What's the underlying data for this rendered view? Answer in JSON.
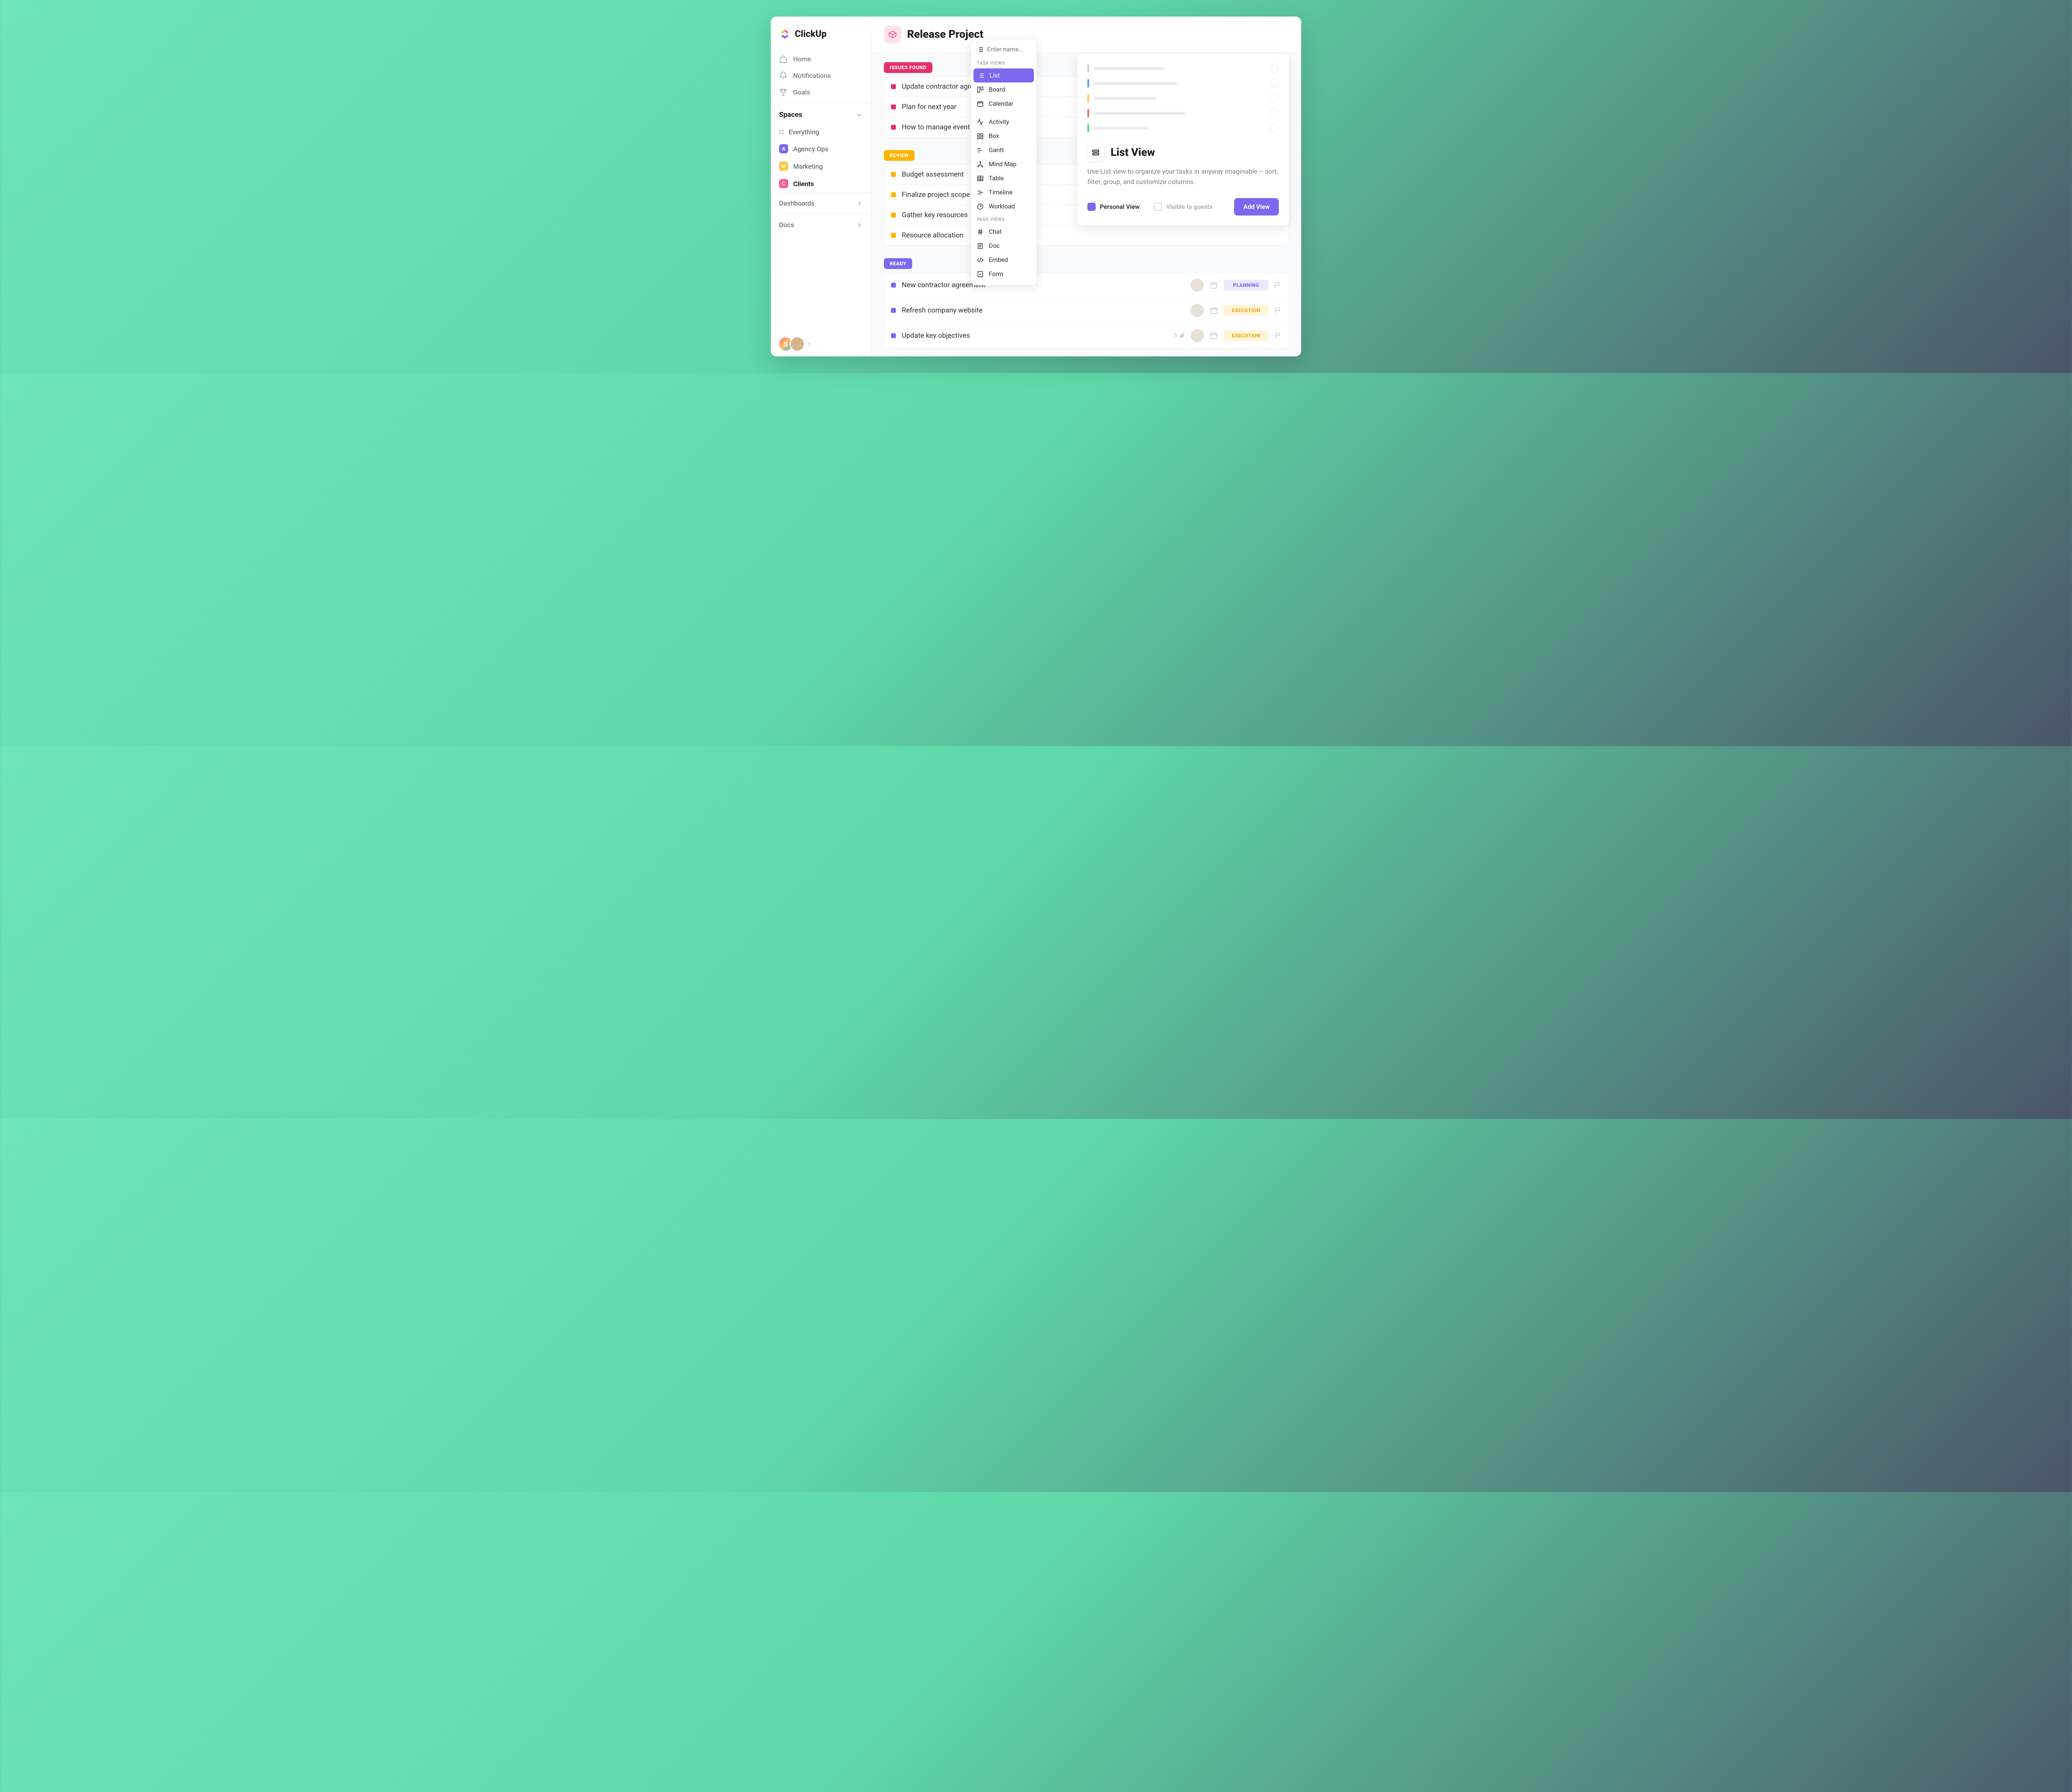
{
  "brand": "ClickUp",
  "nav": {
    "home": "Home",
    "notifications": "Notifications",
    "goals": "Goals"
  },
  "spaces": {
    "header": "Spaces",
    "everything": "Everything",
    "items": [
      {
        "letter": "A",
        "label": "Agency Ops",
        "color": "#7B68EE"
      },
      {
        "letter": "M",
        "label": "Marketing",
        "color": "#FFC53D"
      },
      {
        "letter": "C",
        "label": "Clients",
        "color": "#FF5C93"
      }
    ]
  },
  "dashboards": "Dashboards",
  "docs": "Docs",
  "user": {
    "initial": "S"
  },
  "project": {
    "title": "Release Project"
  },
  "groups": [
    {
      "name": "ISSUES FOUND",
      "color": "#E62E6B",
      "dot": "#E62E6B",
      "tasks": [
        {
          "title": "Update contractor agreement"
        },
        {
          "title": "Plan for next year"
        },
        {
          "title": "How to manage event"
        }
      ]
    },
    {
      "name": "REVIEW",
      "color": "#FFB400",
      "dot": "#FFB400",
      "tasks": [
        {
          "title": "Budget assessment"
        },
        {
          "title": "Finalize project scope"
        },
        {
          "title": "Gather key resources"
        },
        {
          "title": "Resource allocation"
        }
      ]
    },
    {
      "name": "READY",
      "color": "#7B68EE",
      "dot": "#7B68EE",
      "tasks": [
        {
          "title": "New contractor agreement",
          "tag": "PLANNING",
          "tagColor": "#7B68EE",
          "tagBg": "#ECE8FD",
          "assignee": true
        },
        {
          "title": "Refresh company website",
          "tag": "EXECUTION",
          "tagColor": "#E6A817",
          "tagBg": "#FFF4D6",
          "assignee": true
        },
        {
          "title": "Update key objectives",
          "tag": "EXECUTION",
          "tagColor": "#E6A817",
          "tagBg": "#FFF4D6",
          "assignee": true,
          "attach": "5"
        }
      ]
    }
  ],
  "popup": {
    "placeholder": "Enter name...",
    "taskViews": "TASK VIEWS",
    "pageViews": "PAGE VIEWS",
    "items": {
      "list": "List",
      "board": "Board",
      "calendar": "Calendar",
      "activity": "Activity",
      "box": "Box",
      "gantt": "Gantt",
      "mindmap": "Mind Map",
      "table": "Table",
      "timeline": "Timeline",
      "workload": "Workload",
      "chat": "Chat",
      "doc": "Doc",
      "embed": "Embed",
      "form": "Form"
    }
  },
  "panel": {
    "title": "List View",
    "desc": "Use List view to organize your tasks in anyway imaginable – sort, filter, group, and customize columns.",
    "personal": "Personal View",
    "visible": "Visible to guests",
    "add": "Add View",
    "previewColors": [
      "#c8ccd4",
      "#4C9AFF",
      "#FFC53D",
      "#FF5C5C",
      "#4CD964"
    ]
  }
}
